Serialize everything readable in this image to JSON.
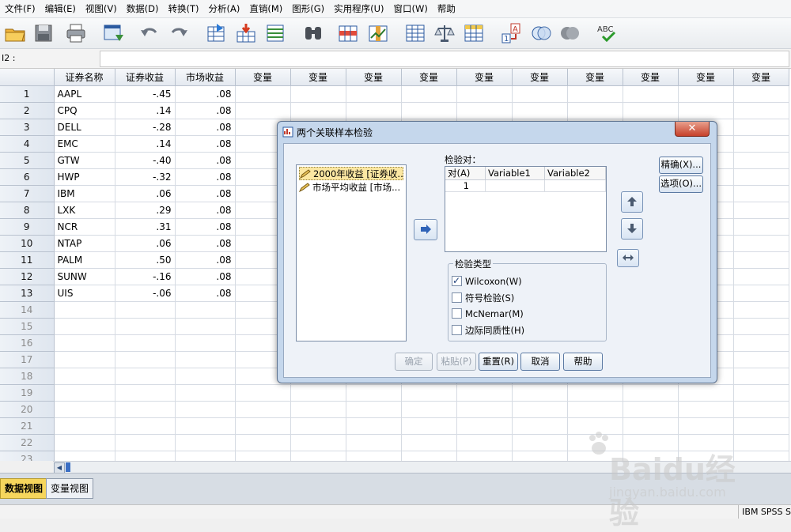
{
  "menu": [
    "文件(F)",
    "编辑(E)",
    "视图(V)",
    "数据(D)",
    "转换(T)",
    "分析(A)",
    "直销(M)",
    "图形(G)",
    "实用程序(U)",
    "窗口(W)",
    "帮助"
  ],
  "toolbar_icons": [
    "open-folder-icon",
    "save-icon",
    "print-icon",
    "recall-dialog-icon",
    "undo-icon",
    "redo-icon",
    "goto-case-icon",
    "goto-variable-icon",
    "variables-icon",
    "find-icon",
    "insert-cases-icon",
    "insert-variable-icon",
    "split-file-icon",
    "weight-cases-icon",
    "select-cases-icon",
    "value-labels-icon",
    "use-sets-icon",
    "show-all-variables-icon",
    "spell-check-icon"
  ],
  "refbar": {
    "cell_ref": "I2 :"
  },
  "grid": {
    "headers": [
      "证券名称",
      "证券收益",
      "市场收益",
      "变量",
      "变量",
      "变量",
      "变量",
      "变量",
      "变量",
      "变量",
      "变量",
      "变量",
      "变量"
    ],
    "rows": [
      {
        "n": "1",
        "name": "AAPL",
        "sec": "-.45",
        "mkt": ".08"
      },
      {
        "n": "2",
        "name": "CPQ",
        "sec": ".14",
        "mkt": ".08"
      },
      {
        "n": "3",
        "name": "DELL",
        "sec": "-.28",
        "mkt": ".08"
      },
      {
        "n": "4",
        "name": "EMC",
        "sec": ".14",
        "mkt": ".08"
      },
      {
        "n": "5",
        "name": "GTW",
        "sec": "-.40",
        "mkt": ".08"
      },
      {
        "n": "6",
        "name": "HWP",
        "sec": "-.32",
        "mkt": ".08"
      },
      {
        "n": "7",
        "name": "IBM",
        "sec": ".06",
        "mkt": ".08"
      },
      {
        "n": "8",
        "name": "LXK",
        "sec": ".29",
        "mkt": ".08"
      },
      {
        "n": "9",
        "name": "NCR",
        "sec": ".31",
        "mkt": ".08"
      },
      {
        "n": "10",
        "name": "NTAP",
        "sec": ".06",
        "mkt": ".08"
      },
      {
        "n": "11",
        "name": "PALM",
        "sec": ".50",
        "mkt": ".08"
      },
      {
        "n": "12",
        "name": "SUNW",
        "sec": "-.16",
        "mkt": ".08"
      },
      {
        "n": "13",
        "name": "UIS",
        "sec": "-.06",
        "mkt": ".08"
      },
      {
        "n": "14",
        "name": "",
        "sec": "",
        "mkt": ""
      },
      {
        "n": "15",
        "name": "",
        "sec": "",
        "mkt": ""
      },
      {
        "n": "16",
        "name": "",
        "sec": "",
        "mkt": ""
      },
      {
        "n": "17",
        "name": "",
        "sec": "",
        "mkt": ""
      },
      {
        "n": "18",
        "name": "",
        "sec": "",
        "mkt": ""
      },
      {
        "n": "19",
        "name": "",
        "sec": "",
        "mkt": ""
      },
      {
        "n": "20",
        "name": "",
        "sec": "",
        "mkt": ""
      },
      {
        "n": "21",
        "name": "",
        "sec": "",
        "mkt": ""
      },
      {
        "n": "22",
        "name": "",
        "sec": "",
        "mkt": ""
      },
      {
        "n": "23",
        "name": "",
        "sec": "",
        "mkt": ""
      }
    ]
  },
  "tabs": {
    "data_view": "数据视图",
    "variable_view": "变量视图"
  },
  "status": {
    "processor": "IBM SPSS S"
  },
  "watermark": {
    "brand": "Baidu经验",
    "url": "jingyan.baidu.com"
  },
  "dialog": {
    "title": "两个关联样本检验",
    "source_vars": [
      "2000年收益 [证券收...",
      "市场平均收益 [市场..."
    ],
    "pairs_label": "检验对：",
    "pairs_headers": [
      "对(A)",
      "Variable1",
      "Variable2"
    ],
    "pairs_rows": [
      [
        "1",
        "",
        ""
      ]
    ],
    "exact_btn": "精确(X)...",
    "options_btn": "选项(O)...",
    "test_type_label": "检验类型",
    "tests": [
      {
        "label": "Wilcoxon(W)",
        "checked": true
      },
      {
        "label": "符号检验(S)",
        "checked": false
      },
      {
        "label": "McNemar(M)",
        "checked": false
      },
      {
        "label": "边际同质性(H)",
        "checked": false
      }
    ],
    "buttons": {
      "ok": "确定",
      "paste": "粘贴(P)",
      "reset": "重置(R)",
      "cancel": "取消",
      "help": "帮助"
    }
  }
}
